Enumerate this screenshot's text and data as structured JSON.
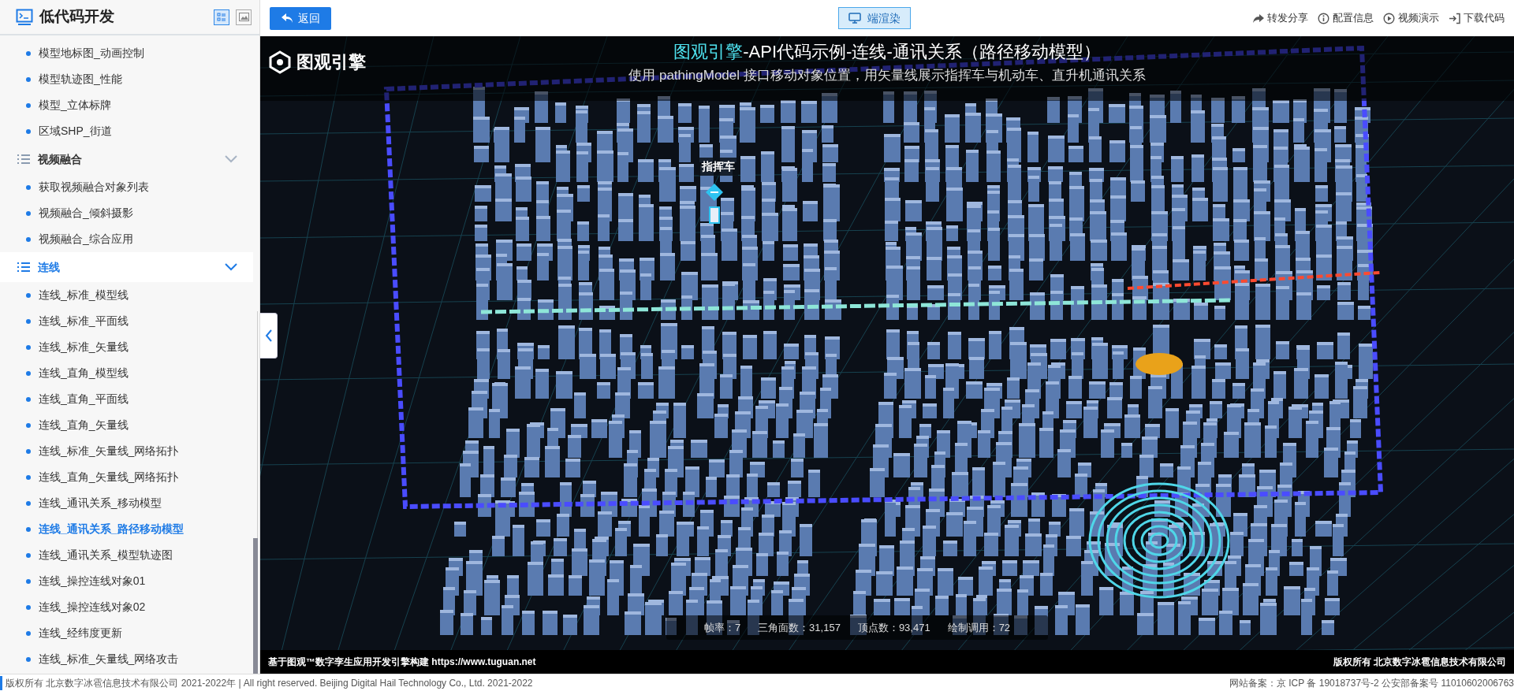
{
  "sidebar": {
    "title": "低代码开发",
    "view_toggles": [
      {
        "kind": "list",
        "selected": true
      },
      {
        "kind": "image",
        "selected": false
      }
    ],
    "leading_items": [
      {
        "label": "模型地标图_动画控制",
        "selected": false
      },
      {
        "label": "模型轨迹图_性能",
        "selected": false
      },
      {
        "label": "模型_立体标牌",
        "selected": false
      },
      {
        "label": "区域SHP_街道",
        "selected": false
      }
    ],
    "groups": [
      {
        "label": "视频融合",
        "selected": false,
        "children": [
          {
            "label": "获取视频融合对象列表",
            "selected": false
          },
          {
            "label": "视频融合_倾斜摄影",
            "selected": false
          },
          {
            "label": "视频融合_综合应用",
            "selected": false
          }
        ]
      },
      {
        "label": "连线",
        "selected": true,
        "children": [
          {
            "label": "连线_标准_模型线",
            "selected": false
          },
          {
            "label": "连线_标准_平面线",
            "selected": false
          },
          {
            "label": "连线_标准_矢量线",
            "selected": false
          },
          {
            "label": "连线_直角_模型线",
            "selected": false
          },
          {
            "label": "连线_直角_平面线",
            "selected": false
          },
          {
            "label": "连线_直角_矢量线",
            "selected": false
          },
          {
            "label": "连线_标准_矢量线_网络拓扑",
            "selected": false
          },
          {
            "label": "连线_直角_矢量线_网络拓扑",
            "selected": false
          },
          {
            "label": "连线_通讯关系_移动模型",
            "selected": false
          },
          {
            "label": "连线_通讯关系_路径移动模型",
            "selected": true
          },
          {
            "label": "连线_通讯关系_模型轨迹图",
            "selected": false
          },
          {
            "label": "连线_操控连线对象01",
            "selected": false
          },
          {
            "label": "连线_操控连线对象02",
            "selected": false
          },
          {
            "label": "连线_经纬度更新",
            "selected": false
          },
          {
            "label": "连线_标准_矢量线_网络攻击",
            "selected": false
          }
        ]
      }
    ]
  },
  "toolbar": {
    "back_button": "返回",
    "render_button": "端渲染",
    "actions": [
      {
        "kind": "share",
        "label": "转发分享"
      },
      {
        "kind": "info",
        "label": "配置信息"
      },
      {
        "kind": "video",
        "label": "视频演示"
      },
      {
        "kind": "download",
        "label": "下载代码"
      }
    ]
  },
  "scene": {
    "logo": "图观引擎",
    "title_highlight": "图观引擎",
    "title": "-API代码示例-连线-通讯关系（路径移动模型）",
    "subtitle": "使用 pathingModel 接口移动对象位置，用矢量线展示指挥车与机动车、直升机通讯关系",
    "vehicle_label": "指挥车",
    "stats": [
      "帧率：7",
      "三角面数：31,157",
      "顶点数：93,471",
      "绘制调用：72"
    ],
    "credit": "基于图观™数字孪生应用开发引擎构建 https://www.tuguan.net",
    "copyright": "版权所有 北京数字冰雹信息技术有限公司"
  },
  "footer": {
    "left": "版权所有 北京数字冰雹信息技术有限公司 2021-2022年 | All right reserved. Beijing Digital Hail Technology Co., Ltd. 2021-2022",
    "right": "网站备案：京 ICP 备 19018737号-2 公安部备案号 11010602006763"
  }
}
